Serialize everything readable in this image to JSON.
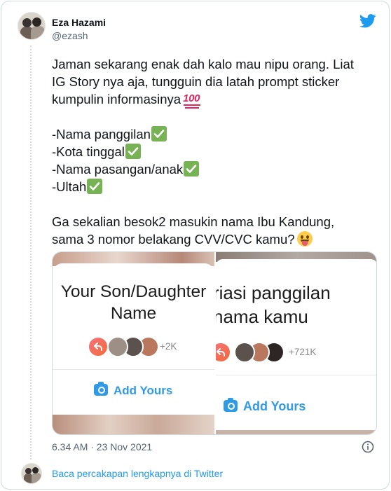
{
  "tweet": {
    "author": {
      "name": "Eza Hazami",
      "handle": "@ezash",
      "avatar_icon": "profile-photo-two-people"
    },
    "logo_icon": "twitter-bird-icon",
    "brand_color": "#1d9bf0",
    "text": {
      "line1": "Jaman sekarang enak dah kalo mau nipu orang. Liat",
      "line2": "IG Story nya aja, tungguin dia latah prompt sticker",
      "line3": "kumpulin informasinya",
      "line3_emoji": "hundred-points-icon",
      "list": [
        "-Nama panggilan",
        "-Kota tinggal",
        "-Nama pasangan/anak",
        "-Ultah"
      ],
      "list_emoji": "check-mark-button-icon",
      "closing1": "Ga sekalian besok2 masukin nama Ibu Kandung,",
      "closing2": "sama 3 nomor belakang CVV/CVC kamu?",
      "closing_emoji": "face-with-tongue-icon"
    },
    "media": [
      {
        "prompt_line1": "Your Son/Daughter",
        "prompt_line2": "Name",
        "participants_count": "+2K",
        "button_label": "Add Yours"
      },
      {
        "prompt_line1": "riasi panggilan",
        "prompt_line2": "nama kamu",
        "participants_count": "+721K",
        "button_label": "Add Yours"
      }
    ],
    "timestamp": "6.34 AM · 23 Nov 2021",
    "read_more": "Baca percakapan lengkapnya di Twitter"
  }
}
